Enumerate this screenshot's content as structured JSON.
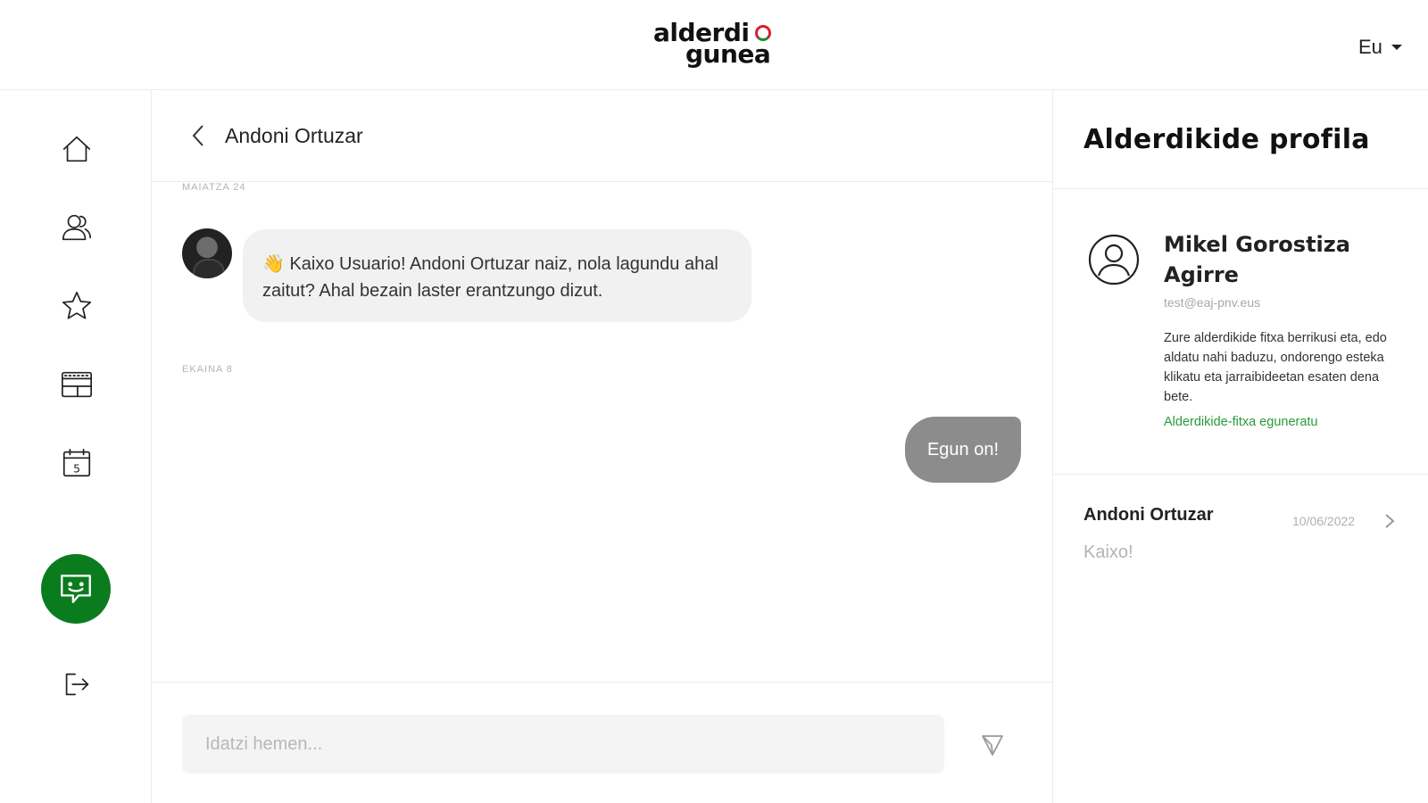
{
  "header": {
    "logo_line1": "alderdi",
    "logo_line2": "gunea",
    "language": "Eu"
  },
  "sidebar": {
    "items": [
      {
        "icon": "home-icon"
      },
      {
        "icon": "users-icon"
      },
      {
        "icon": "star-icon"
      },
      {
        "icon": "news-icon"
      },
      {
        "icon": "calendar-icon"
      },
      {
        "icon": "chat-icon",
        "active": true
      },
      {
        "icon": "logout-icon"
      }
    ],
    "calendar_day": "5"
  },
  "chat": {
    "title": "Andoni Ortuzar",
    "sections": [
      {
        "date": "MAIATZA 24"
      },
      {
        "date": "EKAINA 8"
      }
    ],
    "incoming_message": "👋 Kaixo Usuario! Andoni Ortuzar naiz, nola lagundu ahal zaitut? Ahal bezain laster erantzungo dizut.",
    "outgoing_message": "Egun on!",
    "input_placeholder": "Idatzi hemen..."
  },
  "profile": {
    "title": "Alderdikide profila",
    "name": "Mikel Gorostiza Agirre",
    "email": "test@eaj-pnv.eus",
    "description": "Zure alderdikide fitxa berrikusi eta, edo aldatu nahi baduzu, ondorengo esteka klikatu eta jarraibideetan esaten dena bete.",
    "link_label": "Alderdikide-fitxa eguneratu",
    "conversation": {
      "name": "Andoni Ortuzar",
      "date": "10/06/2022",
      "preview": "Kaixo!"
    }
  },
  "colors": {
    "accent_green": "#0b7c1e",
    "link_green": "#2a9a3a",
    "outgoing_bubble": "#8c8c8c",
    "incoming_bubble": "#f1f1f1"
  }
}
